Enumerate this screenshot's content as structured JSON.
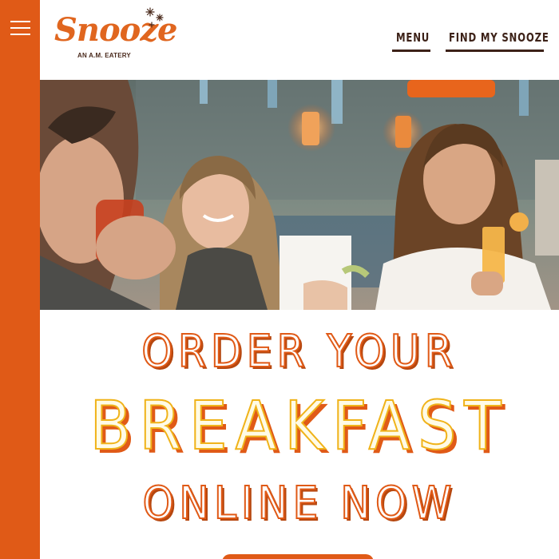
{
  "colors": {
    "brand_orange": "#e05a17",
    "brand_brown": "#3d2218",
    "accent_yellow": "#f0b31a"
  },
  "sidebar": {
    "menu_icon": "hamburger-menu-icon"
  },
  "logo": {
    "wordmark": "Snooze",
    "tagline": "AN A.M. EATERY"
  },
  "nav": {
    "menu_label": "MENU",
    "find_label": "FIND MY SNOOZE"
  },
  "headline": {
    "line1": "ORDER YOUR",
    "line2": "BREAKFAST",
    "line3": "ONLINE NOW"
  }
}
